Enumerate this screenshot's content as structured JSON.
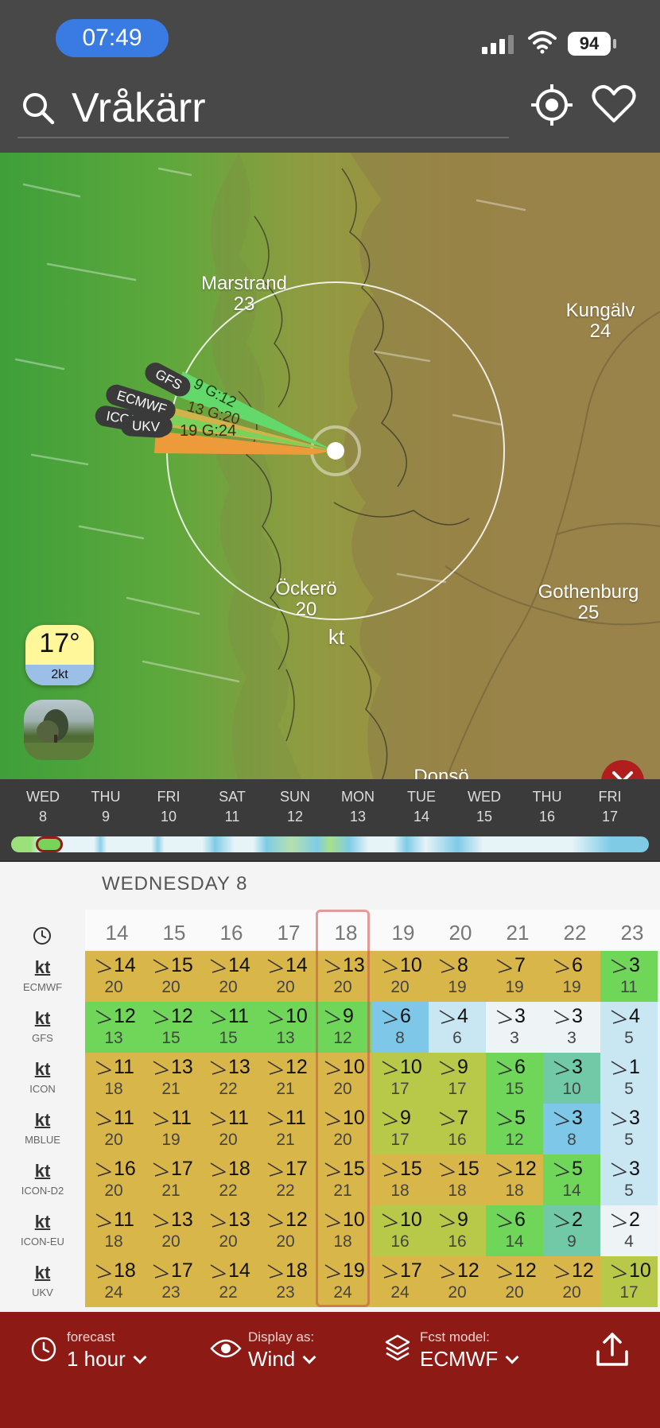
{
  "status_bar": {
    "time": "07:49",
    "battery": "94"
  },
  "header": {
    "location": "Vråkärr"
  },
  "map": {
    "cities": [
      {
        "name": "Marstrand",
        "value": "23"
      },
      {
        "name": "Kungälv",
        "value": "24"
      },
      {
        "name": "Öckerö",
        "value": "20"
      },
      {
        "name": "Gothenburg",
        "value": "25"
      },
      {
        "name": "Donsö",
        "value": ""
      }
    ],
    "unit": "kt",
    "model_tags": [
      {
        "model": "GFS",
        "value": "9 G:12",
        "color": "#63d86b"
      },
      {
        "model": "ECMWF",
        "value": "13 G:20",
        "color": "#d2b24a"
      },
      {
        "model": "ICON-EU",
        "value": "",
        "color": "#79d35a"
      },
      {
        "model": "UKV",
        "value": "19 G:24",
        "color": "#ec9a3a"
      }
    ],
    "temperature": "17°",
    "wind_small": "2kt"
  },
  "days": [
    {
      "dow": "WED",
      "date": "8"
    },
    {
      "dow": "THU",
      "date": "9"
    },
    {
      "dow": "FRI",
      "date": "10"
    },
    {
      "dow": "SAT",
      "date": "11"
    },
    {
      "dow": "SUN",
      "date": "12"
    },
    {
      "dow": "MON",
      "date": "13"
    },
    {
      "dow": "TUE",
      "date": "14"
    },
    {
      "dow": "WED",
      "date": "15"
    },
    {
      "dow": "THU",
      "date": "16"
    },
    {
      "dow": "FRI",
      "date": "17"
    }
  ],
  "table": {
    "day_title": "WEDNESDAY 8",
    "hours": [
      "14",
      "15",
      "16",
      "17",
      "18",
      "19",
      "20",
      "21",
      "22",
      "23"
    ],
    "selected_hour": "18",
    "unit": "kt",
    "rows": [
      {
        "model": "ECMWF",
        "speeds": [
          "14",
          "15",
          "14",
          "14",
          "13",
          "10",
          "8",
          "7",
          "6",
          "3"
        ],
        "gusts": [
          "20",
          "20",
          "20",
          "20",
          "20",
          "20",
          "19",
          "19",
          "19",
          "11"
        ]
      },
      {
        "model": "GFS",
        "speeds": [
          "12",
          "12",
          "11",
          "10",
          "9",
          "6",
          "4",
          "3",
          "3",
          "4"
        ],
        "gusts": [
          "13",
          "15",
          "15",
          "13",
          "12",
          "8",
          "6",
          "3",
          "3",
          "5"
        ]
      },
      {
        "model": "ICON",
        "speeds": [
          "11",
          "13",
          "13",
          "12",
          "10",
          "10",
          "9",
          "6",
          "3",
          "1"
        ],
        "gusts": [
          "18",
          "21",
          "22",
          "21",
          "20",
          "17",
          "17",
          "15",
          "10",
          "5"
        ]
      },
      {
        "model": "MBLUE",
        "speeds": [
          "11",
          "11",
          "11",
          "11",
          "10",
          "9",
          "7",
          "5",
          "3",
          "3"
        ],
        "gusts": [
          "20",
          "19",
          "20",
          "21",
          "20",
          "17",
          "16",
          "12",
          "8",
          "5"
        ]
      },
      {
        "model": "ICON-D2",
        "speeds": [
          "16",
          "17",
          "18",
          "17",
          "15",
          "15",
          "15",
          "12",
          "5",
          "3"
        ],
        "gusts": [
          "20",
          "21",
          "22",
          "22",
          "21",
          "18",
          "18",
          "18",
          "14",
          "5"
        ]
      },
      {
        "model": "ICON-EU",
        "speeds": [
          "11",
          "13",
          "13",
          "12",
          "10",
          "10",
          "9",
          "6",
          "2",
          "2"
        ],
        "gusts": [
          "18",
          "20",
          "20",
          "20",
          "18",
          "16",
          "16",
          "14",
          "9",
          "4"
        ]
      },
      {
        "model": "UKV",
        "speeds": [
          "18",
          "17",
          "14",
          "18",
          "19",
          "17",
          "12",
          "12",
          "12",
          "10"
        ],
        "gusts": [
          "24",
          "23",
          "22",
          "23",
          "24",
          "24",
          "20",
          "20",
          "20",
          "17"
        ]
      }
    ]
  },
  "bottom_bar": {
    "forecast_label": "forecast",
    "forecast_value": "1 hour",
    "display_label": "Display as:",
    "display_value": "Wind",
    "model_label": "Fcst model:",
    "model_value": "ECMWF"
  }
}
